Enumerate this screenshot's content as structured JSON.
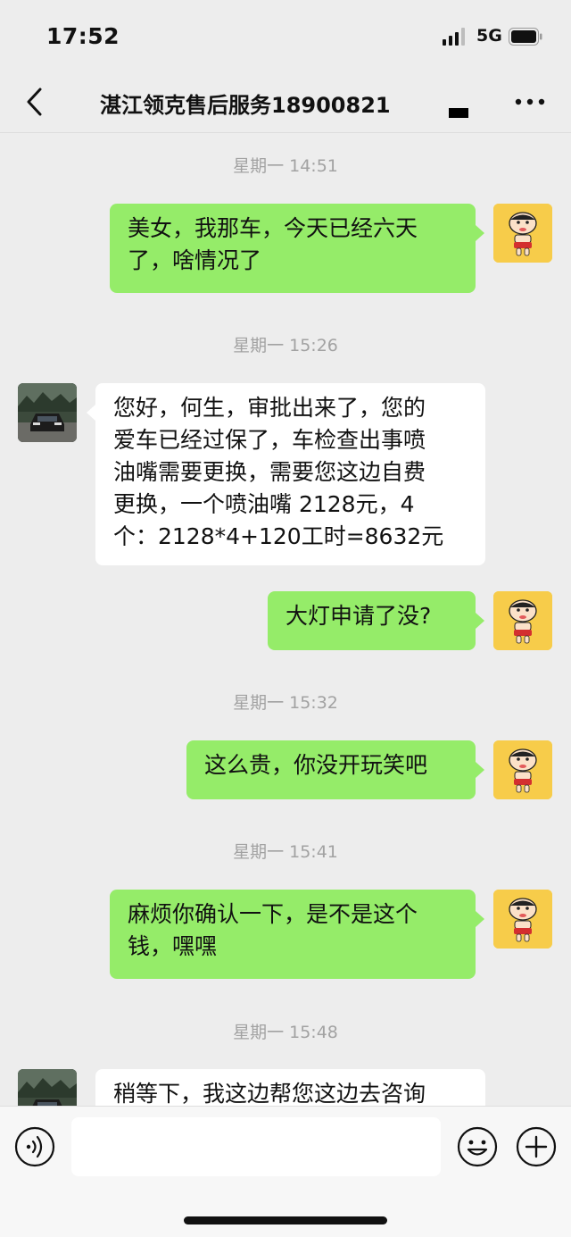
{
  "status_bar": {
    "time": "17:52",
    "network": "5G"
  },
  "header": {
    "title": "湛江领克售后服务18900821"
  },
  "messages": [
    {
      "type": "timestamp",
      "text": "星期一 14:51"
    },
    {
      "type": "sent",
      "text": "美女，我那车，今天已经六天\n了，啥情况了"
    },
    {
      "type": "timestamp",
      "text": "星期一 15:26"
    },
    {
      "type": "received",
      "text": "您好，何生，审批出来了，您的\n爱车已经过保了，车检查出事喷\n油嘴需要更换，需要您这边自费\n更换，一个喷油嘴 2128元，4\n个：2128*4+120工时=8632元"
    },
    {
      "type": "sent",
      "text": "大灯申请了没?"
    },
    {
      "type": "timestamp",
      "text": "星期一 15:32"
    },
    {
      "type": "sent",
      "text": "这么贵，你没开玩笑吧"
    },
    {
      "type": "timestamp",
      "text": "星期一 15:41"
    },
    {
      "type": "sent",
      "text": "麻烦你确认一下，是不是这个\n钱，嘿嘿"
    },
    {
      "type": "timestamp",
      "text": "星期一 15:48"
    },
    {
      "type": "received",
      "text": "稍等下，我这边帮您这边去咨询"
    }
  ],
  "icons": {
    "back": "chevron-left-icon",
    "more": "more-icon",
    "voice": "voice-icon",
    "emoji": "emoji-icon",
    "plus": "plus-icon"
  },
  "colors": {
    "background": "#ededed",
    "sent_bubble": "#95ec69",
    "received_bubble": "#ffffff",
    "timestamp_text": "#a2a2a2",
    "self_avatar": "#f7cc4a"
  },
  "input": {
    "value": ""
  }
}
